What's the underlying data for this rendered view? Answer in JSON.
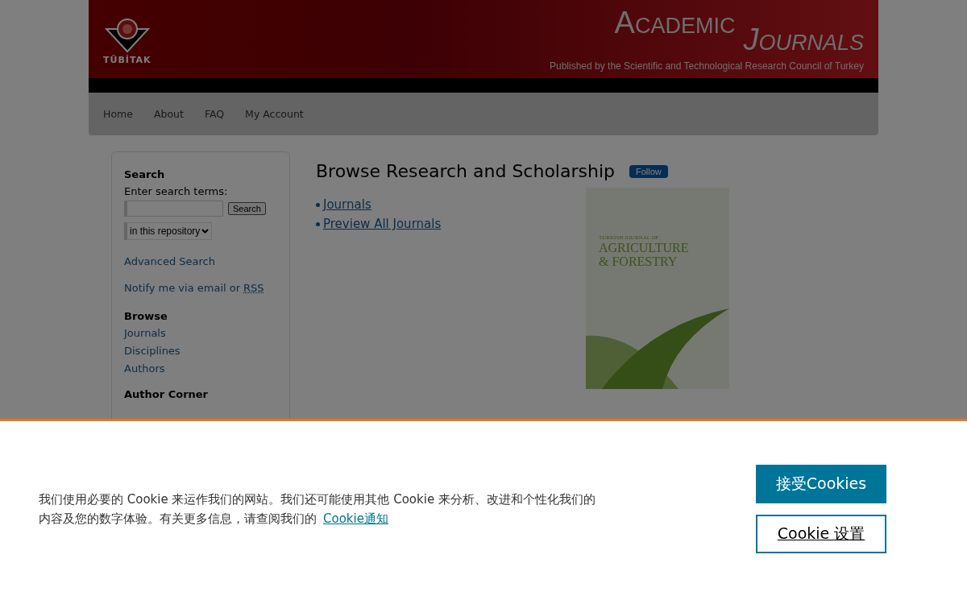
{
  "header": {
    "logo_text": "TÜBİTAK",
    "title_1": "Academic",
    "title_2": "Journals",
    "subtitle": "Published by the Scientific and Technological Research Council of Turkey"
  },
  "nav": [
    {
      "label": "Home"
    },
    {
      "label": "About"
    },
    {
      "label": "FAQ"
    },
    {
      "label": "My Account"
    }
  ],
  "sidebar": {
    "search_heading": "Search",
    "search_label": "Enter search terms:",
    "search_button": "Search",
    "scope_select": "in this repository",
    "advanced_link": "Advanced Search",
    "notify_text": "Notify me via email or",
    "rss_link": "RSS",
    "browse_heading": "Browse",
    "browse_links": [
      "Journals",
      "Disciplines",
      "Authors"
    ],
    "author_heading": "Author Corner"
  },
  "main": {
    "title": "Browse Research and Scholarship",
    "follow_button": "Follow",
    "links": [
      "Journals",
      "Preview All Journals"
    ],
    "cover": {
      "kicker": "TURKISH JOURNAL OF",
      "title_1": "AGRICULTURE",
      "title_2": "& FORESTRY"
    }
  },
  "cookie_banner": {
    "text": "我们使用必要的 Cookie 来运作我们的网站。我们还可能使用其他 Cookie 来分析、改进和个性化我们的内容及您的数字体验。有关更多信息，请查阅我们的",
    "link": "Cookie通知",
    "accept_button": "接受Cookies",
    "settings_button": "Cookie 设置"
  }
}
